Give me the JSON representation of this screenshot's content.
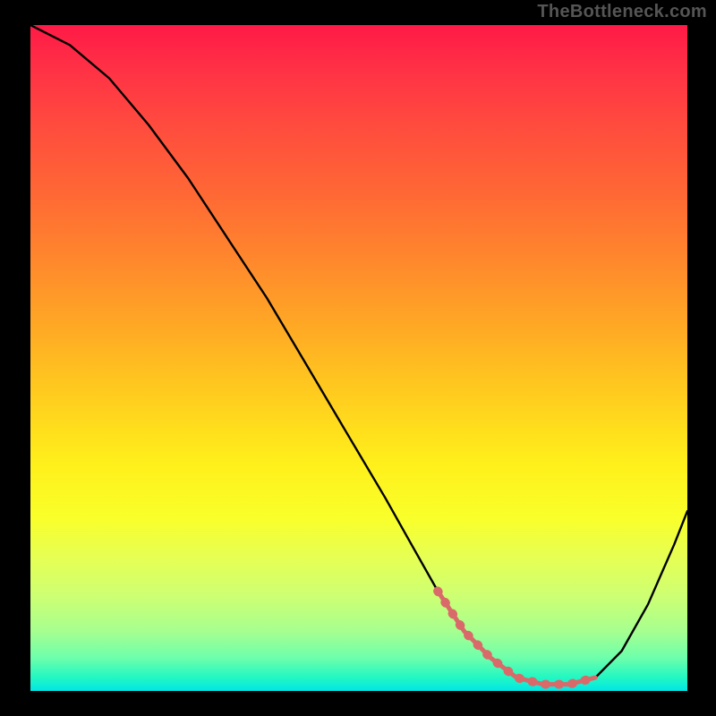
{
  "watermark": "TheBottleneck.com",
  "chart_data": {
    "type": "line",
    "title": "",
    "xlabel": "",
    "ylabel": "",
    "xlim": [
      0,
      100
    ],
    "ylim": [
      0,
      100
    ],
    "curve": {
      "x": [
        0,
        6,
        12,
        18,
        24,
        30,
        36,
        42,
        48,
        54,
        58,
        62,
        66,
        70,
        74,
        78,
        82,
        86,
        90,
        94,
        98,
        100
      ],
      "y": [
        100,
        97,
        92,
        85,
        77,
        68,
        59,
        49,
        39,
        29,
        22,
        15,
        9,
        5,
        2,
        1,
        1,
        2,
        6,
        13,
        22,
        27
      ]
    },
    "highlight_segment": {
      "color": "#e06666",
      "x": [
        62,
        66,
        70,
        74,
        78,
        82,
        86
      ],
      "y": [
        15,
        9,
        5,
        2,
        1,
        1,
        2
      ]
    },
    "gradient_stops": [
      {
        "pos": 0.0,
        "color": "#ff1a46"
      },
      {
        "pos": 0.15,
        "color": "#ff4b3e"
      },
      {
        "pos": 0.36,
        "color": "#ff8a2c"
      },
      {
        "pos": 0.56,
        "color": "#ffce1e"
      },
      {
        "pos": 0.74,
        "color": "#f9ff2a"
      },
      {
        "pos": 0.91,
        "color": "#a7ff8f"
      },
      {
        "pos": 1.0,
        "color": "#00e6e6"
      }
    ]
  }
}
